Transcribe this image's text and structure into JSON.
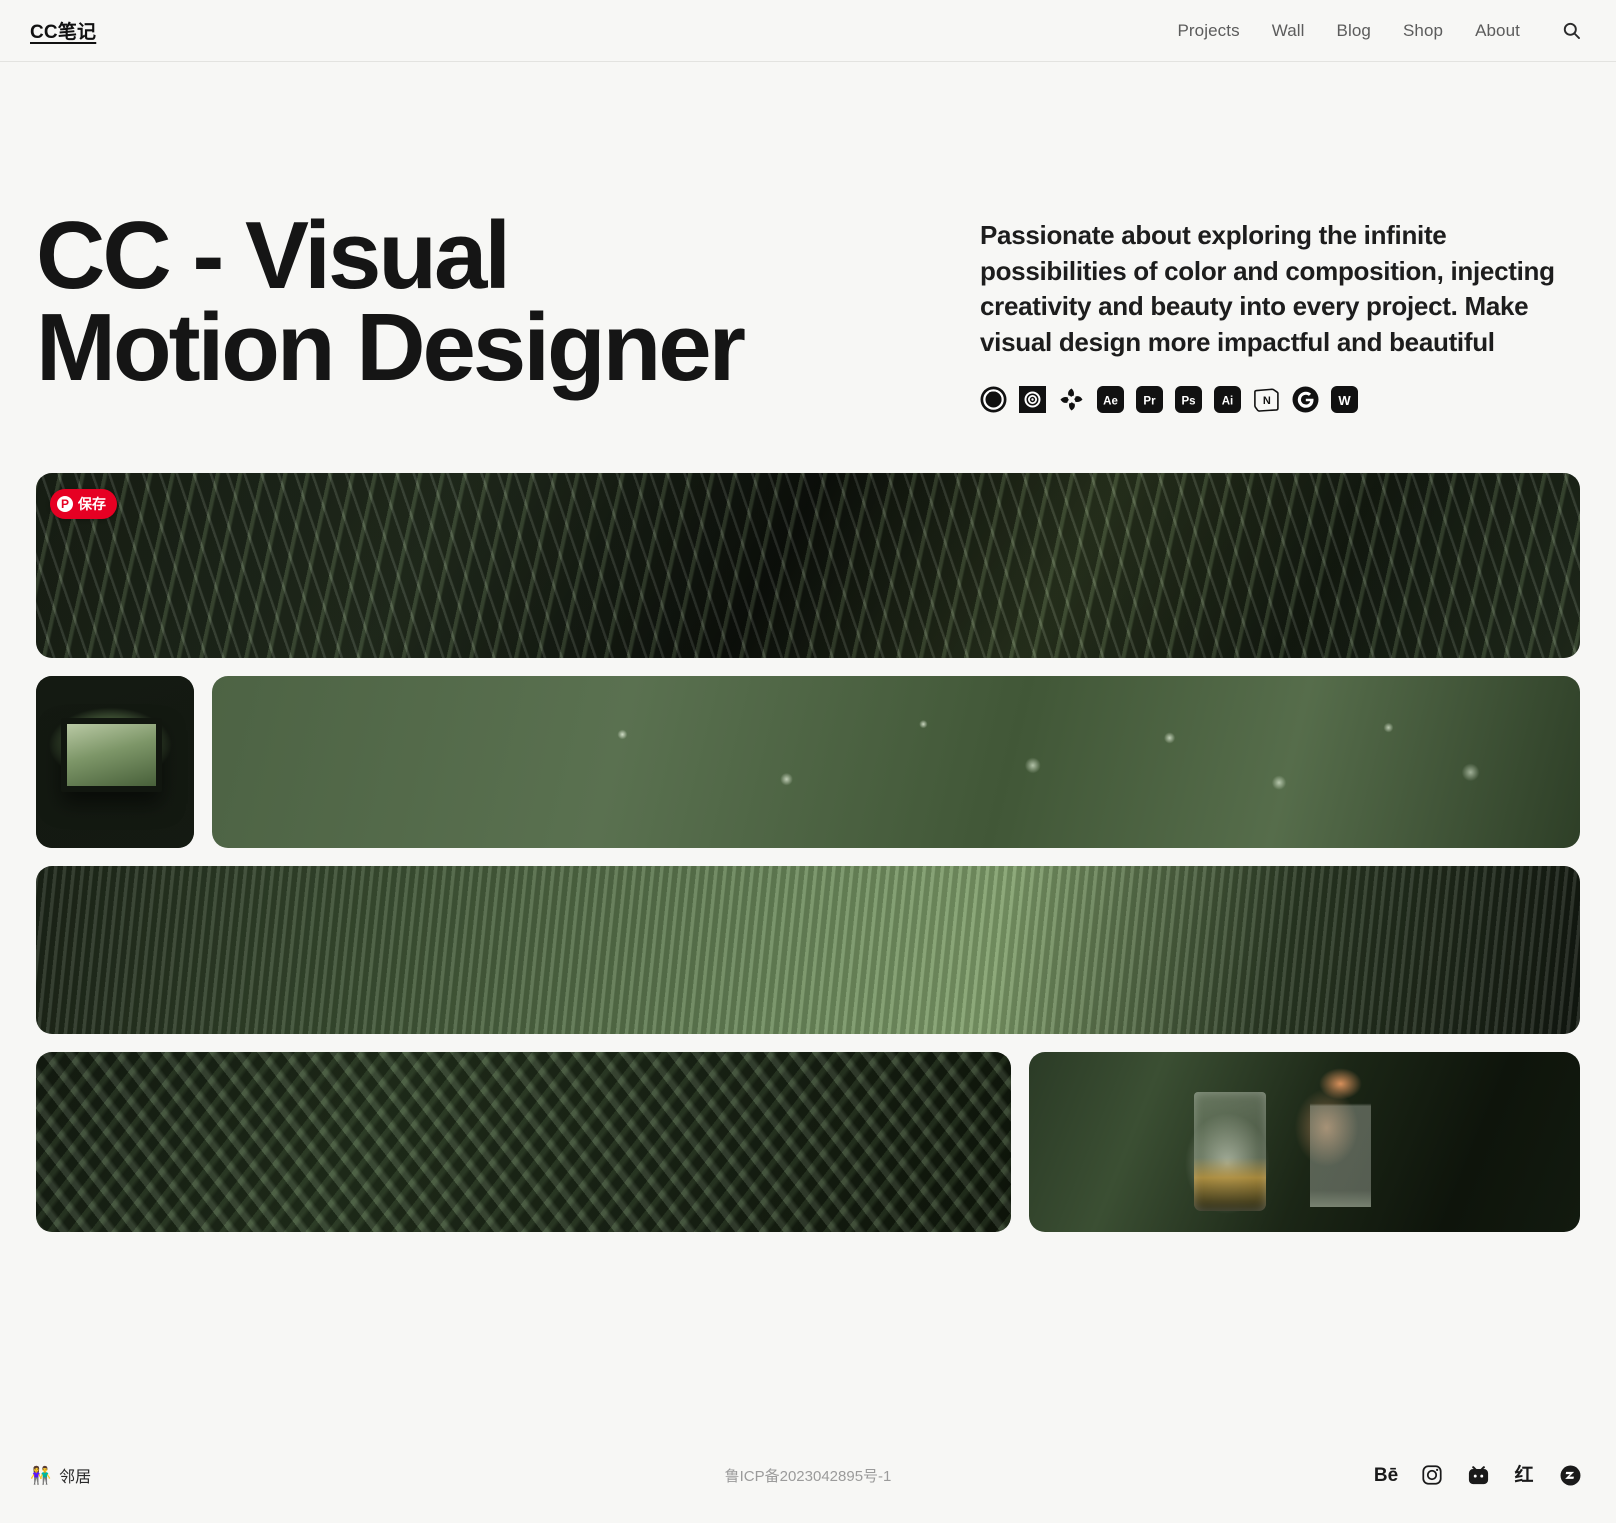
{
  "header": {
    "logo": "CC笔记",
    "nav": [
      {
        "label": "Projects"
      },
      {
        "label": "Wall"
      },
      {
        "label": "Blog"
      },
      {
        "label": "Shop"
      },
      {
        "label": "About"
      }
    ],
    "search_icon": "search-icon"
  },
  "hero": {
    "headline_line1": "CC - Visual",
    "headline_line2": "Motion Designer",
    "tagline": "Passionate about exploring the infinite possibilities of color and composition, injecting creativity and beauty into every project. Make visual design more impactful and beautiful",
    "tools": [
      {
        "name": "cinema4d-icon",
        "label": "C4D"
      },
      {
        "name": "cinema4d-spiral-icon",
        "label": "C4D Spiral"
      },
      {
        "name": "houdini-icon",
        "label": "Houdini"
      },
      {
        "name": "after-effects-icon",
        "label": "Ae"
      },
      {
        "name": "premiere-pro-icon",
        "label": "Pr"
      },
      {
        "name": "photoshop-icon",
        "label": "Ps"
      },
      {
        "name": "illustrator-icon",
        "label": "Ai"
      },
      {
        "name": "notion-icon",
        "label": "N"
      },
      {
        "name": "google-icon",
        "label": "G"
      },
      {
        "name": "wordpress-icon",
        "label": "W"
      }
    ]
  },
  "gallery": {
    "pin_badge": {
      "icon": "pinterest-icon",
      "label": "保存"
    },
    "tiles": [
      {
        "name": "tile-palm-leaves",
        "alt": "Dark green palm fronds close-up"
      },
      {
        "name": "tile-window",
        "alt": "Dark window looking onto green foliage"
      },
      {
        "name": "tile-water-droplets",
        "alt": "Water droplets on a green leaf surface"
      },
      {
        "name": "tile-striped-light",
        "alt": "Green corrugated surface with light streak"
      },
      {
        "name": "tile-rope-texture",
        "alt": "Coiled dark green rope texture"
      },
      {
        "name": "tile-cocktail-glasses",
        "alt": "Cocktail glasses on green velvet cloth"
      }
    ]
  },
  "footer": {
    "neighbors": {
      "emoji": "👫",
      "label": "邻居"
    },
    "icp": "鲁ICP备2023042895号-1",
    "socials": [
      {
        "name": "behance-icon",
        "label": "Bē"
      },
      {
        "name": "instagram-icon",
        "label": "Instagram"
      },
      {
        "name": "bilibili-icon",
        "label": "Bilibili"
      },
      {
        "name": "xiaohongshu-icon",
        "label": "红"
      },
      {
        "name": "zcool-icon",
        "label": "Zcool"
      }
    ]
  },
  "colors": {
    "background": "#f7f7f5",
    "text": "#151515",
    "muted": "#9b9b9b",
    "nav": "#5c5c5c",
    "pinterest_red": "#e60023"
  }
}
